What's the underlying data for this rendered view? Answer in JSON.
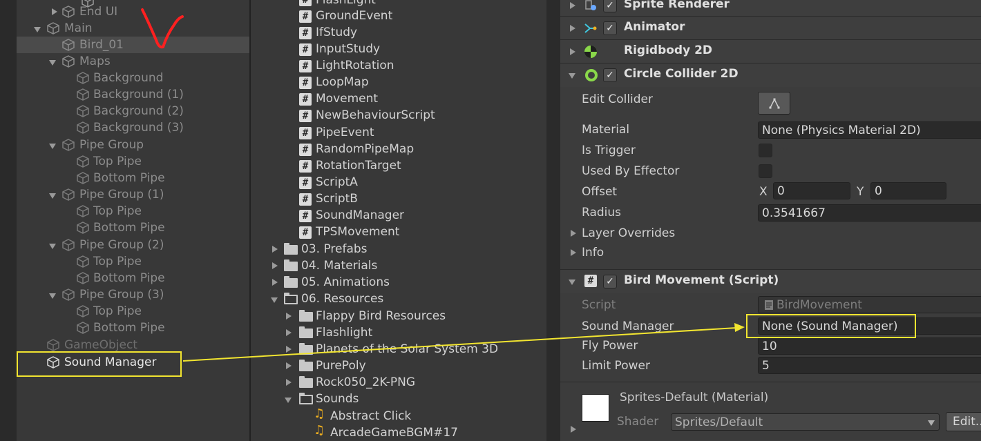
{
  "hierarchy": {
    "items": [
      {
        "label": "End UI"
      },
      {
        "label": "Main"
      },
      {
        "label": "Bird_01"
      },
      {
        "label": "Maps"
      },
      {
        "label": "Background"
      },
      {
        "label": "Background (1)"
      },
      {
        "label": "Background (2)"
      },
      {
        "label": "Background (3)"
      },
      {
        "label": "Pipe Group"
      },
      {
        "label": "Top Pipe"
      },
      {
        "label": "Bottom Pipe"
      },
      {
        "label": "Pipe Group (1)"
      },
      {
        "label": "Top Pipe"
      },
      {
        "label": "Bottom Pipe"
      },
      {
        "label": "Pipe Group (2)"
      },
      {
        "label": "Top Pipe"
      },
      {
        "label": "Bottom Pipe"
      },
      {
        "label": "Pipe Group (3)"
      },
      {
        "label": "Top Pipe"
      },
      {
        "label": "Bottom Pipe"
      },
      {
        "label": "GameObject"
      },
      {
        "label": "Sound Manager"
      }
    ]
  },
  "project": {
    "scripts": [
      "FlashLight",
      "GroundEvent",
      "IfStudy",
      "InputStudy",
      "LightRotation",
      "LoopMap",
      "Movement",
      "NewBehaviourScript",
      "PipeEvent",
      "RandomPipeMap",
      "RotationTarget",
      "ScriptA",
      "ScriptB",
      "SoundManager",
      "TPSMovement"
    ],
    "folders": [
      "03. Prefabs",
      "04. Materials",
      "05. Animations",
      "06. Resources"
    ],
    "resources": [
      "Flappy Bird Resources",
      "Flashlight",
      "Planets of the Solar System 3D",
      "PurePoly",
      "Rock050_2K-PNG",
      "Sounds"
    ],
    "sounds": [
      "Abstract Click",
      "ArcadeGameBGM#17"
    ]
  },
  "inspector": {
    "components": {
      "sprite_renderer": "Sprite Renderer",
      "animator": "Animator",
      "rigidbody": "Rigidbody 2D",
      "circle_collider": "Circle Collider 2D",
      "bird_movement": "Bird Movement (Script)"
    },
    "collider": {
      "edit_collider": "Edit Collider",
      "material_label": "Material",
      "material_value": "None (Physics Material 2D)",
      "is_trigger": "Is Trigger",
      "used_by_effector": "Used By Effector",
      "offset": "Offset",
      "x_label": "X",
      "x_value": "0",
      "y_label": "Y",
      "y_value": "0",
      "radius": "Radius",
      "radius_value": "0.3541667",
      "layer_overrides": "Layer Overrides",
      "info": "Info"
    },
    "script": {
      "script_label": "Script",
      "script_value": "BirdMovement",
      "sound_manager_label": "Sound Manager",
      "sound_manager_value": "None (Sound Manager)",
      "fly_power_label": "Fly Power",
      "fly_power_value": "10",
      "limit_power_label": "Limit Power",
      "limit_power_value": "5"
    },
    "material": {
      "name": "Sprites-Default (Material)",
      "shader_label": "Shader",
      "shader_value": "Sprites/Default",
      "edit_label": "Edit..."
    }
  },
  "colors": {
    "highlight": "#f2e530",
    "annotation": "#ff2020"
  }
}
